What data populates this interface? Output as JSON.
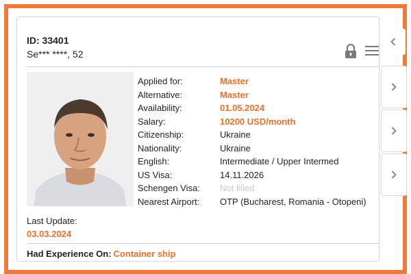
{
  "card": {
    "id": "ID: 33401",
    "name_age": "Se*** ****, 52",
    "last_update_label": "Last Update:",
    "last_update": "03.03.2024",
    "fields": {
      "applied_for": {
        "label": "Applied for:",
        "value": "Master"
      },
      "alternative": {
        "label": "Alternative:",
        "value": "Master"
      },
      "availability": {
        "label": "Availability:",
        "value": "01.05.2024"
      },
      "salary": {
        "label": "Salary:",
        "value": "10200 USD/month"
      },
      "citizenship": {
        "label": "Citizenship:",
        "value": "Ukraine"
      },
      "nationality": {
        "label": "Nationality:",
        "value": "Ukraine"
      },
      "english": {
        "label": "English:",
        "value": "Intermediate / Upper Intermed"
      },
      "us_visa": {
        "label": "US Visa:",
        "value": "14.11.2026"
      },
      "schengen_visa": {
        "label": "Schengen Visa:",
        "value": "Not filled"
      },
      "nearest_airport": {
        "label": "Nearest Airport:",
        "value": "OTP (Bucharest, Romania - Otopeni)"
      }
    },
    "experience_label": "Had Experience On:",
    "experience_value": "Container ship"
  },
  "icons": {
    "lock": "lock-icon",
    "menu": "hamburger-menu-icon",
    "collapse": "chevron-left-icon",
    "side_next": "chevron-right-icon"
  },
  "colors": {
    "accent": "#e6722e",
    "frame": "#f07a3c"
  }
}
